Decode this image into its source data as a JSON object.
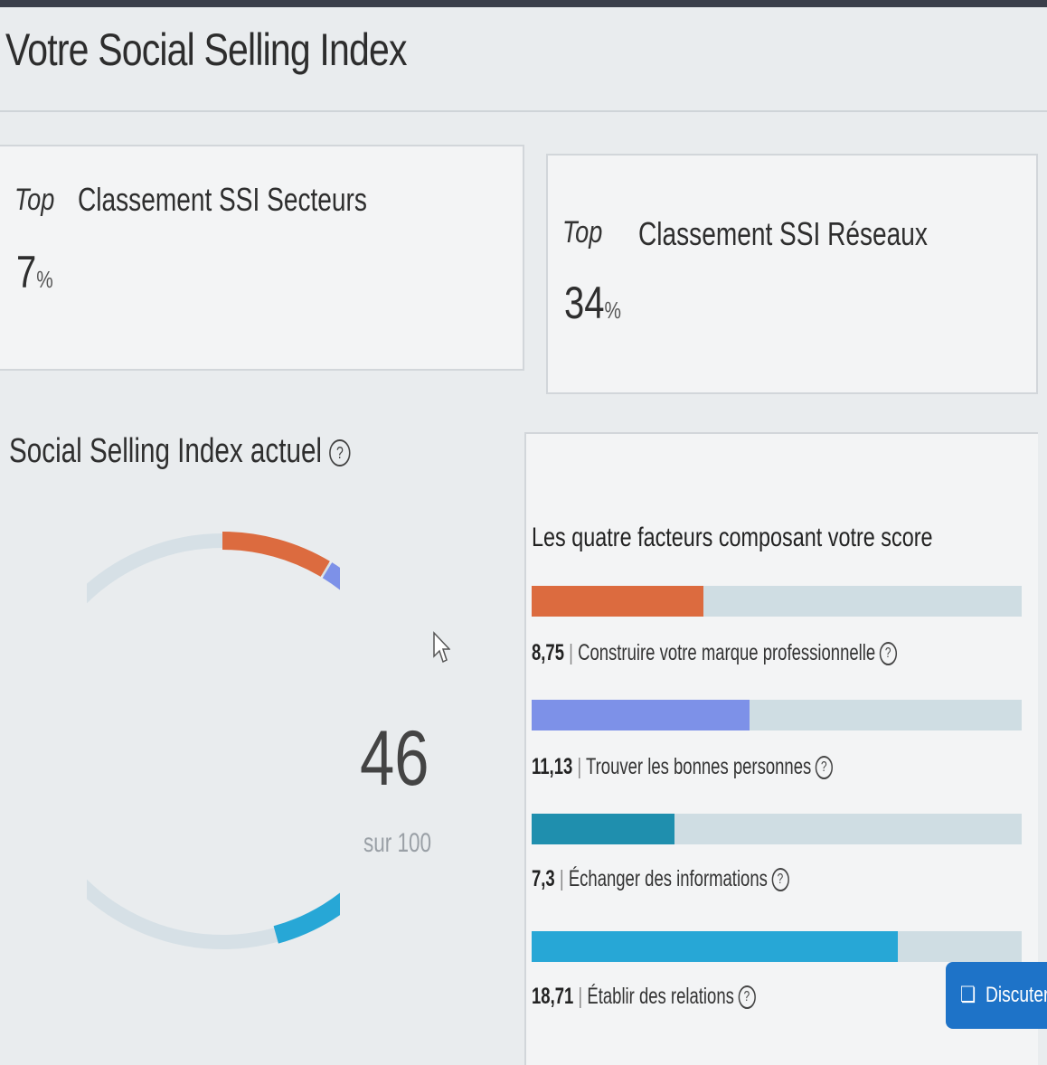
{
  "page": {
    "title": "Votre Social Selling Index"
  },
  "rankings": [
    {
      "top_label": "Top",
      "label": "Classement SSI Secteurs",
      "value": "7",
      "unit": "%"
    },
    {
      "top_label": "Top",
      "label": "Classement SSI Réseaux",
      "value": "34",
      "unit": "%"
    }
  ],
  "ssi": {
    "title": "Social Selling Index actuel",
    "help_icon": "help-circle-icon",
    "score": "46",
    "score_sub": "sur 100",
    "max": 100
  },
  "factors": {
    "title": "Les quatre facteurs composant votre score",
    "max_per_factor": 25,
    "items": [
      {
        "value": "8,75",
        "label": "Construire votre marque professionnelle",
        "fraction": 0.35,
        "color": "#dc6b3f"
      },
      {
        "value": "11,13",
        "label": "Trouver les bonnes personnes",
        "fraction": 0.445,
        "color": "#7d91e8"
      },
      {
        "value": "7,3",
        "label": "Échanger des informations",
        "fraction": 0.292,
        "color": "#1f8fae"
      },
      {
        "value": "18,71",
        "label": "Établir des relations",
        "fraction": 0.748,
        "color": "#27a7d6"
      }
    ]
  },
  "colors": {
    "track": "#cfdde3",
    "accent": "#1e73c8"
  },
  "chat": {
    "label": "Discuter av",
    "icon": "chat-icon"
  }
}
